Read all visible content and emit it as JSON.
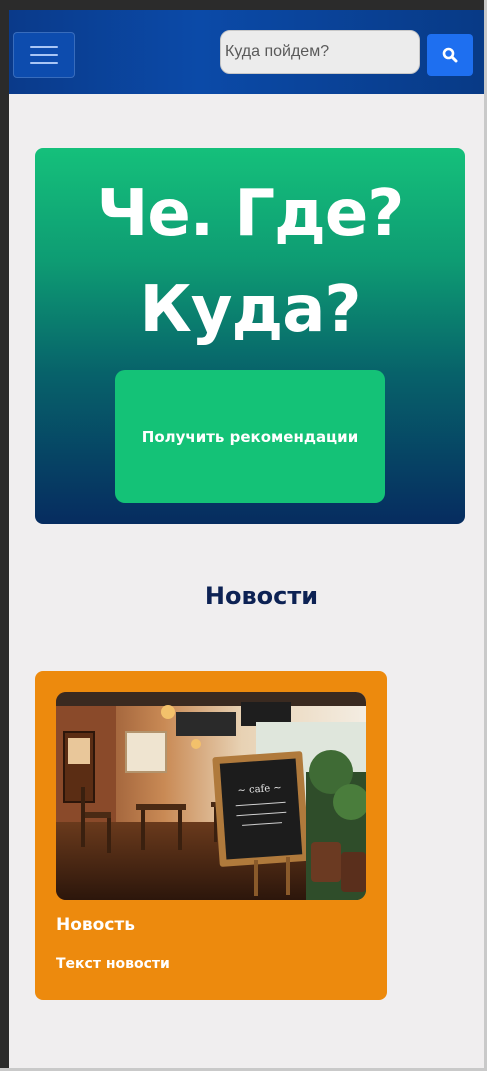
{
  "header": {
    "search_placeholder": "Куда пойдем?"
  },
  "hero": {
    "title_line1": "Че. Где?",
    "title_line2": "Куда?",
    "cta_label": "Получить рекомендации"
  },
  "news": {
    "section_title": "Новости",
    "items": [
      {
        "title": "Новость",
        "text": "Текст новости"
      }
    ]
  },
  "colors": {
    "navbar": "#0b4aa8",
    "search_button": "#1e6ff0",
    "hero_top": "#15c07b",
    "hero_bottom": "#062c60",
    "cta": "#14c277",
    "section_title": "#0d2254",
    "news_card": "#ed8a0d",
    "background": "#f0eeef"
  },
  "icons": {
    "menu": "hamburger-icon",
    "search": "search-icon"
  }
}
